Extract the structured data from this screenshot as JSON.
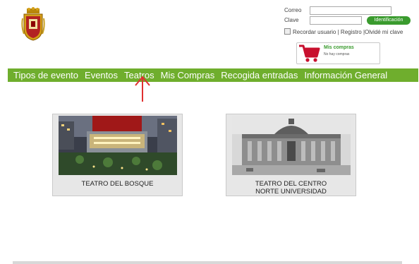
{
  "login": {
    "email_label": "Correo",
    "password_label": "Clave",
    "submit_label": "Identificación",
    "remember_label": "Recordar usuario",
    "register_link": "Registro",
    "forgot_link": "Olvidé mi clave",
    "separator": "|"
  },
  "cart": {
    "title": "Mis compras",
    "status": "No hay compras"
  },
  "nav": {
    "items": [
      "Tipos de evento",
      "Eventos",
      "Teatros",
      "Mis Compras",
      "Recogida entradas",
      "Información General"
    ]
  },
  "theaters": [
    {
      "name": "TEATRO DEL BOSQUE"
    },
    {
      "name": "TEATRO DEL CENTRO\nNORTE UNIVERSIDAD"
    }
  ],
  "colors": {
    "nav_bg": "#6fae2d",
    "button_green": "#3a9b2e",
    "cart_red": "#c8102e",
    "annotation_arrow": "#e03030"
  },
  "icons": {
    "crest": "coat-of-arms-icon",
    "cart": "shopping-cart-icon",
    "arrow": "annotation-arrow-icon"
  }
}
